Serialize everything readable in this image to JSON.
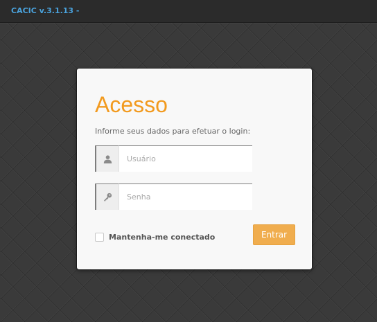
{
  "header": {
    "brand": "CACIC v.3.1.13 -"
  },
  "login": {
    "title": "Acesso",
    "subtitle": "Informe seus dados para efetuar o login:",
    "username": {
      "placeholder": "Usuário",
      "value": "",
      "icon": "user-icon"
    },
    "password": {
      "placeholder": "Senha",
      "value": "",
      "icon": "key-icon"
    },
    "remember_label": "Mantenha-me conectado",
    "remember_checked": false,
    "submit_label": "Entrar"
  },
  "colors": {
    "accent": "#f29a1e",
    "button": "#f0ad4e",
    "brand": "#4aa2dc",
    "background": "#3a3a3a",
    "topbar": "#2b2b2b"
  }
}
